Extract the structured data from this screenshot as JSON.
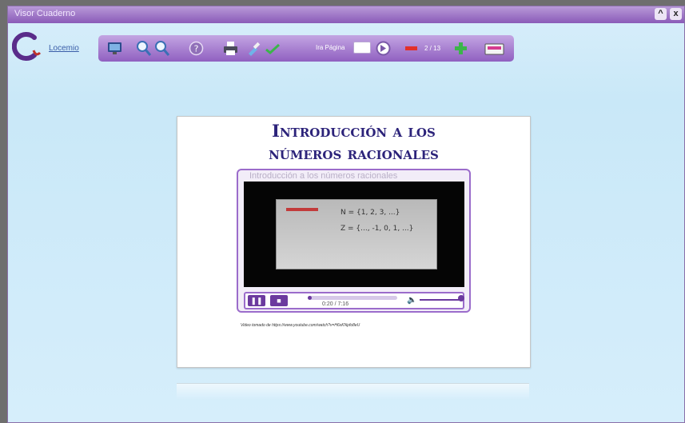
{
  "window": {
    "title": "Visor Cuaderno",
    "collapse_icon": "^",
    "close_icon": "x"
  },
  "logo": {
    "text": "Locemio",
    "icon": "cuaderno-logo-icon"
  },
  "toolbar": {
    "icons": [
      "monitor-icon",
      "zoom-in-icon",
      "zoom-out-icon",
      "help-icon",
      "print-icon",
      "brush-icon",
      "check-icon",
      "go-icon",
      "minus-icon",
      "plus-icon",
      "folder-icon"
    ],
    "goto_label": "Ira Página",
    "page_input_value": "",
    "page_count": "2 / 13"
  },
  "colors": {
    "accent": "#9b6ccb",
    "toolbar": "#a57bd0",
    "title_text": "#2c237a",
    "background": "#d2ecfa"
  },
  "document": {
    "title_line1": "Introducción a los",
    "title_line2": "números racionales",
    "video": {
      "title": "Introducción a los números racionales",
      "time": "0:20 / 7:16",
      "progress": 0.046,
      "volume": 1.0,
      "board_line1": "N = {1, 2, 3, ...}",
      "board_line2": "Z = {..., -1, 0, 1, ...}"
    },
    "caption": "Video tomado de https://www.youtube.com/watch?v=H6xKNpfo8eU"
  }
}
